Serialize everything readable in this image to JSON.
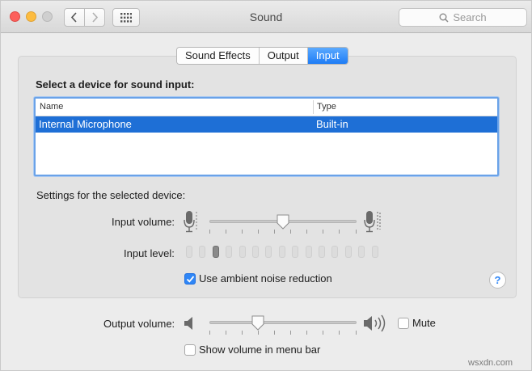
{
  "window": {
    "title": "Sound"
  },
  "toolbar": {
    "search_placeholder": "Search"
  },
  "tabs": [
    {
      "label": "Sound Effects",
      "active": false
    },
    {
      "label": "Output",
      "active": false
    },
    {
      "label": "Input",
      "active": true
    }
  ],
  "input": {
    "heading": "Select a device for sound input:",
    "columns": [
      "Name",
      "Type"
    ],
    "devices": [
      {
        "name": "Internal Microphone",
        "type": "Built-in",
        "selected": true
      }
    ],
    "settings_heading": "Settings for the selected device:",
    "volume_label": "Input volume:",
    "volume_level": 0.5,
    "level_label": "Input level:",
    "level_segments_total": 15,
    "level_segments_lit": 3,
    "noise_reduction_label": "Use ambient noise reduction",
    "noise_reduction_checked": true
  },
  "output": {
    "volume_label": "Output volume:",
    "volume_level": 0.33,
    "mute_label": "Mute",
    "mute_checked": false,
    "menu_bar_label": "Show volume in menu bar",
    "menu_bar_checked": false
  },
  "help": {
    "label": "?"
  },
  "watermark": "wsxdn.com",
  "colors": {
    "accent": "#1e6fd6",
    "close": "#fc605c",
    "minimize": "#fdbc40"
  }
}
